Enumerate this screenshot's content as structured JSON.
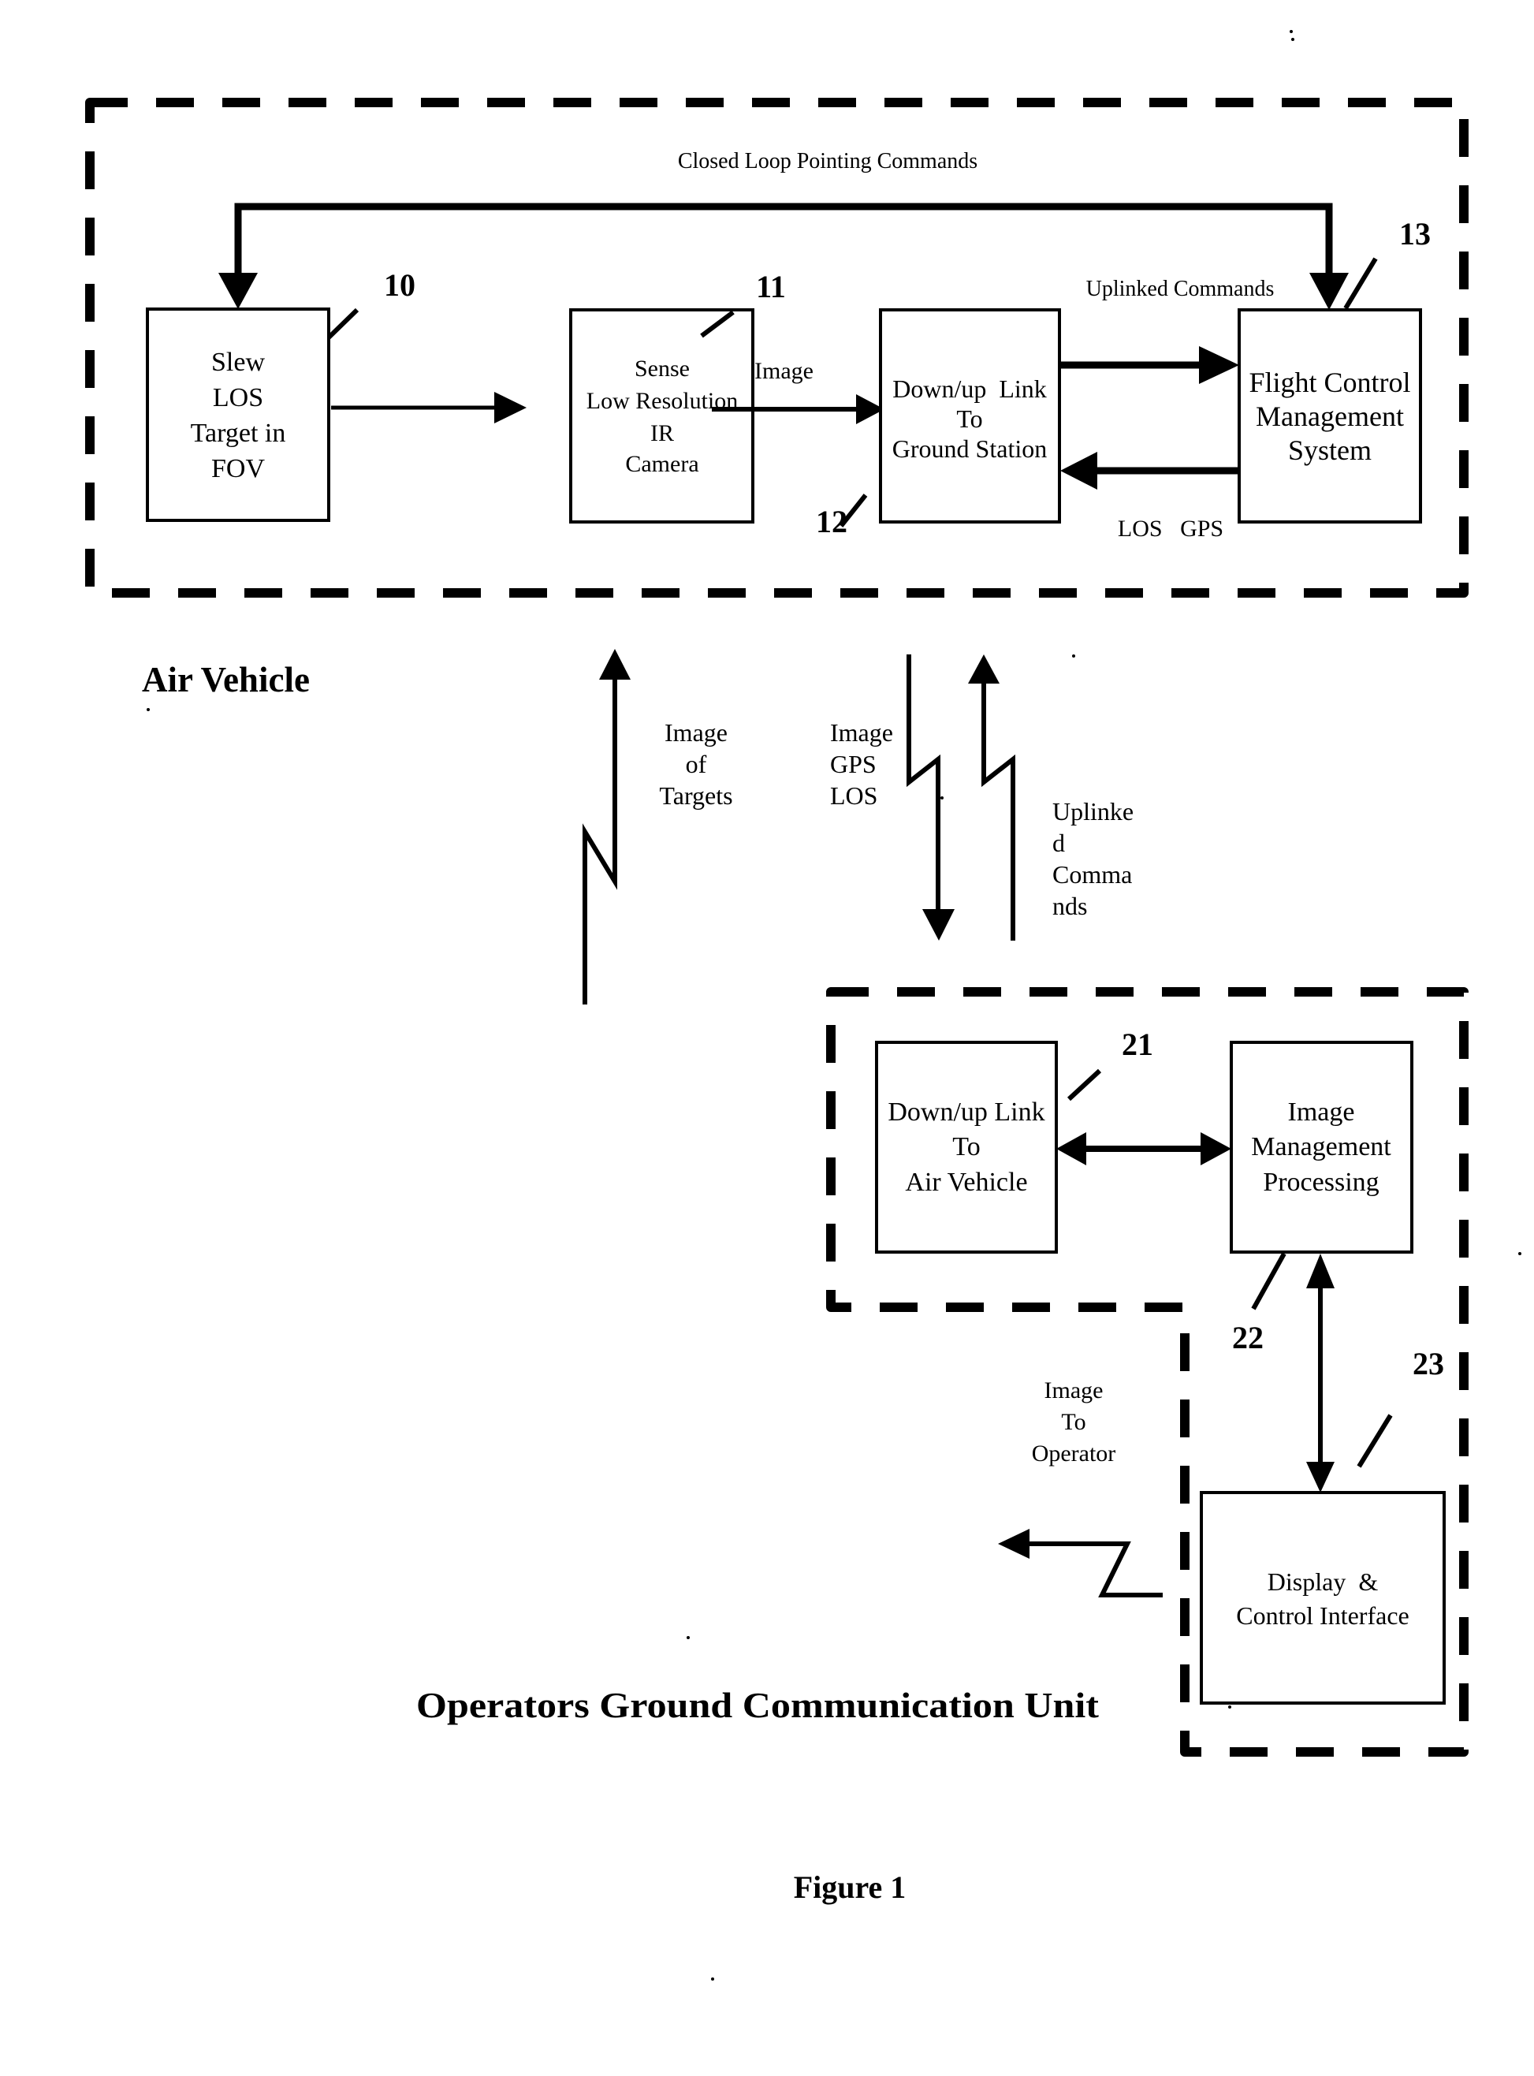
{
  "figure": {
    "caption": "Figure 1"
  },
  "air_vehicle": {
    "title": "Air Vehicle",
    "closed_loop_label": "Closed Loop Pointing Commands",
    "uplinked_commands_label": "Uplinked Commands",
    "image_label": "Image",
    "los_gps_label": "LOS   GPS",
    "blocks": [
      {
        "ref": "10",
        "lines": [
          "Slew",
          "LOS",
          "Target in",
          "FOV"
        ]
      },
      {
        "ref": "11",
        "lines": [
          "Sense",
          "Low Resolution",
          "IR",
          "Camera"
        ]
      },
      {
        "ref": "12",
        "lines": [
          "Down/up  Link",
          "To",
          "Ground Station"
        ]
      },
      {
        "ref": "13",
        "lines": [
          "Flight Control",
          "Management",
          "System"
        ]
      }
    ]
  },
  "links": {
    "image_of_targets": [
      "Image",
      "of",
      "Targets"
    ],
    "downlink": [
      "Image",
      "GPS",
      "LOS"
    ],
    "uplink": [
      "Uplinke",
      "d",
      "Comma",
      "nds"
    ]
  },
  "ground_unit": {
    "title": "Operators Ground Communication Unit",
    "image_to_operator": [
      "Image",
      "To",
      "Operator"
    ],
    "blocks": [
      {
        "ref": "21",
        "lines": [
          "Down/up Link",
          "To",
          "Air Vehicle"
        ]
      },
      {
        "ref": "22",
        "lines": [
          "Image",
          "Management",
          "Processing"
        ]
      },
      {
        "ref": "23",
        "lines": [
          "Display  &",
          "Control Interface"
        ]
      }
    ]
  }
}
